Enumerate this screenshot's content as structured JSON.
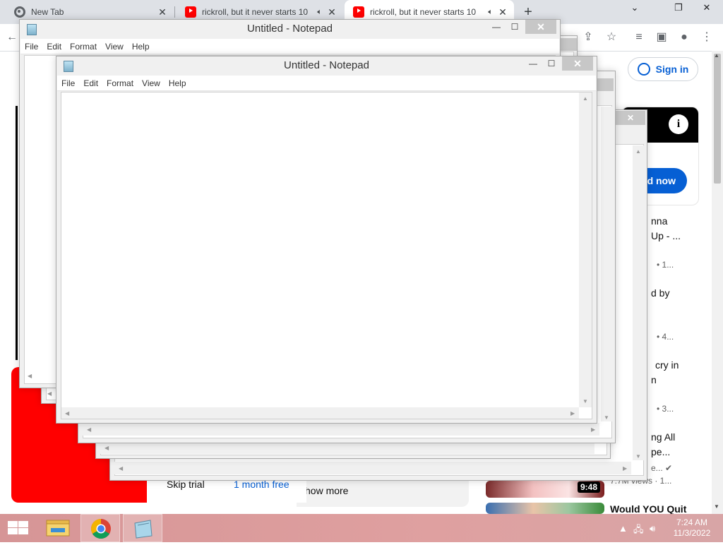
{
  "browser": {
    "tabs": [
      {
        "title": "New Tab",
        "favicon": "chrome-icon",
        "active": false
      },
      {
        "title": "rickroll, but it never starts 10",
        "favicon": "youtube-icon",
        "active": false
      },
      {
        "title": "rickroll, but it never starts 10",
        "favicon": "youtube-icon",
        "active": true
      }
    ],
    "new_tab_label": "+",
    "window_controls": {
      "min": "⌄",
      "restore": "❐",
      "close": "✕"
    }
  },
  "youtube": {
    "sign_in_label": "Sign in",
    "ad_button_label": "d now",
    "sidebar_items": [
      {
        "title_line1": "nna",
        "title_line2": "Up - ...",
        "meta": "• 1..."
      },
      {
        "title_line1": "d by",
        "title_line2": "",
        "meta": "• 4..."
      },
      {
        "title_line1": "cry in",
        "title_line2": "n",
        "meta": "• 3..."
      },
      {
        "title_line1": "ng All",
        "title_line2": "pe...",
        "meta": "e... ✔"
      },
      {
        "title_line1": "Would YOU Quit",
        "title_line2": "",
        "meta": ""
      }
    ],
    "duration_badge": "9:48",
    "views_meta": "7.7M views · 1...",
    "skip_trial": "Skip trial",
    "month_free": "1 month free",
    "show_more": "how more"
  },
  "notepad_windows": [
    {
      "title": "Untitled - Notepad",
      "menu": [
        "File",
        "Edit",
        "Format",
        "View",
        "Help"
      ]
    },
    {
      "title": "Untitled - Notepad",
      "menu": [
        "File",
        "Edit",
        "Format",
        "View",
        "Help"
      ]
    }
  ],
  "taskbar": {
    "time": "7:24 AM",
    "date": "11/3/2022",
    "buttons": [
      "start-button",
      "file-explorer",
      "chrome",
      "notepad"
    ]
  },
  "colors": {
    "youtube_red": "#ff0000",
    "youtube_blue": "#065fd4",
    "taskbar": "#d69596"
  }
}
